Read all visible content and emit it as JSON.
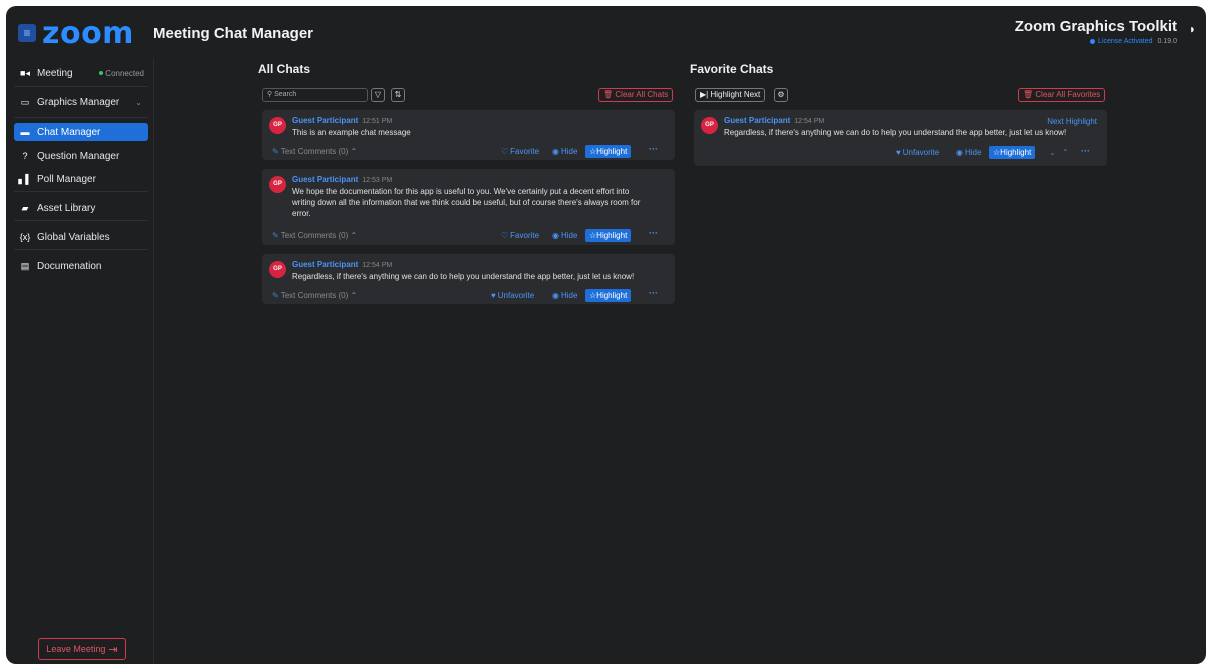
{
  "header": {
    "menu_icon": "hamburger-icon",
    "logo": "zoom",
    "app_title": "Meeting Chat Manager",
    "toolkit_title": "Zoom Graphics Toolkit",
    "license_status": "License Activated",
    "version": "0.19.0",
    "collapse_icon": "half-moon-icon"
  },
  "sidebar": {
    "meeting_label": "Meeting",
    "connection_status": "Connected",
    "items": [
      {
        "label": "Graphics Manager",
        "icon": "monitor-icon"
      },
      {
        "label": "Chat Manager",
        "icon": "chat-bubble-icon"
      },
      {
        "label": "Question Manager",
        "icon": "question-icon"
      },
      {
        "label": "Poll Manager",
        "icon": "bar-chart-icon"
      },
      {
        "label": "Asset Library",
        "icon": "image-icon"
      },
      {
        "label": "Global Variables",
        "icon": "variable-icon"
      },
      {
        "label": "Documenation",
        "icon": "document-icon"
      }
    ],
    "leave_label": "Leave Meeting"
  },
  "all_chats": {
    "title": "All Chats",
    "search_placeholder": "Search",
    "clear_label": "Clear All Chats",
    "messages": [
      {
        "initials": "GP",
        "name": "Guest Participant",
        "time": "12:51 PM",
        "lines": [
          "This is an example chat message"
        ],
        "comments": "Text Comments (0)",
        "favorite": "Favorite",
        "hide": "Hide",
        "highlight": "Highlight"
      },
      {
        "initials": "GP",
        "name": "Guest Participant",
        "time": "12:53 PM",
        "lines": [
          "We hope the documentation for this app is useful to you. We've certainly put a decent effort into",
          "writing down all the information that we think could be useful, but of course there's always room for",
          "error."
        ],
        "comments": "Text Comments (0)",
        "favorite": "Favorite",
        "hide": "Hide",
        "highlight": "Highlight"
      },
      {
        "initials": "GP",
        "name": "Guest Participant",
        "time": "12:54 PM",
        "lines": [
          "Regardless, if there's anything we can do to help you understand the app better, just let us know!"
        ],
        "comments": "Text Comments (0)",
        "favorite": "Unfavorite",
        "hide": "Hide",
        "highlight": "Highlight"
      }
    ]
  },
  "favorite_chats": {
    "title": "Favorite Chats",
    "highlight_next_label": "Highlight Next",
    "clear_label": "Clear All Favorites",
    "messages": [
      {
        "initials": "GP",
        "name": "Guest Participant",
        "time": "12:54 PM",
        "next_highlight": "Next Highlight",
        "lines": [
          "Regardless, if there's anything we can do to help you understand the app better, just let us know!"
        ],
        "favorite": "Unfavorite",
        "hide": "Hide",
        "highlight": "Highlight"
      }
    ]
  }
}
